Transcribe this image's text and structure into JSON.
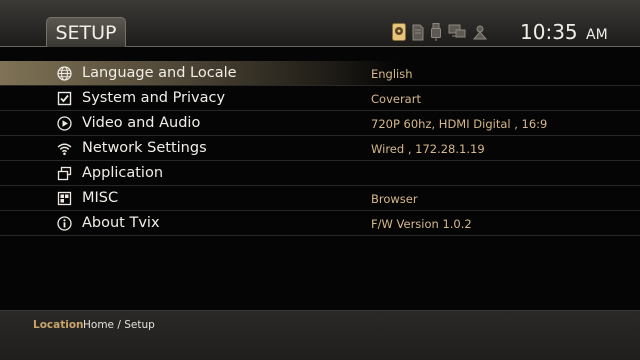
{
  "header": {
    "tab_label": "SETUP",
    "time": "10:35",
    "ampm": "AM",
    "status_icons": [
      "hdd-icon",
      "sd-card-icon",
      "usb-icon",
      "network-share-icon",
      "upnp-icon"
    ]
  },
  "menu": {
    "items": [
      {
        "label": "Language and Locale",
        "value": "English",
        "icon": "globe-icon"
      },
      {
        "label": "System and Privacy",
        "value": "Coverart",
        "icon": "checkbox-icon"
      },
      {
        "label": "Video and Audio",
        "value": "720P 60hz, HDMI Digital , 16:9",
        "icon": "play-icon"
      },
      {
        "label": "Network Settings",
        "value": "Wired , 172.28.1.19",
        "icon": "wifi-icon"
      },
      {
        "label": "Application",
        "value": "",
        "icon": "windows-icon"
      },
      {
        "label": "MISC",
        "value": "Browser",
        "icon": "grid-icon"
      },
      {
        "label": "About Tvix",
        "value": "F/W Version 1.0.2",
        "icon": "info-icon"
      }
    ]
  },
  "footer": {
    "location_label": "Location",
    "location_path": "Home / Setup"
  },
  "colors": {
    "accent": "#c8a56a",
    "value_text": "#d6b88a",
    "selected_row": "#7f7255"
  }
}
